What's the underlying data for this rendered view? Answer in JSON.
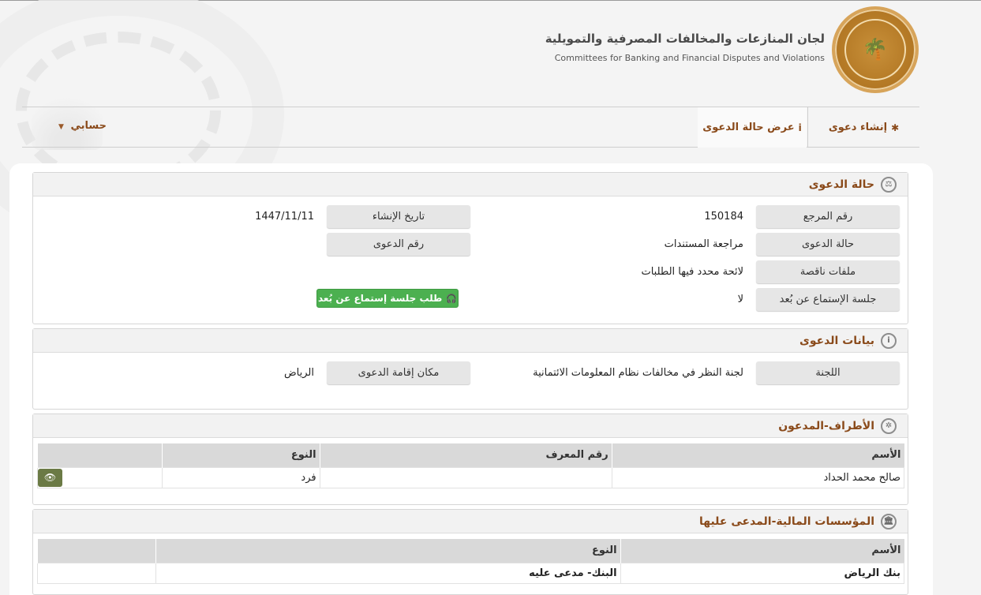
{
  "header": {
    "org_name_ar": "لجان المنازعات والمخالفات المصرفية والتمويلية",
    "org_name_en": "Committees for Banking and Financial Disputes and Violations",
    "logo_icon": "palm-swords-emblem"
  },
  "nav": {
    "create_case": "إنشاء دعوى",
    "create_case_icon": "✱",
    "view_case": "عرض حالة الدعوى",
    "view_case_icon": "i",
    "account": "حسابي",
    "account_caret": "▼"
  },
  "case_status": {
    "title": "حالة الدعوى",
    "ref_label": "رقم المرجع",
    "ref_value": "150184",
    "created_label": "تاريخ الإنشاء",
    "created_value": "1447/11/11",
    "status_label": "حالة الدعوى",
    "status_value": "مراجعة المستندات",
    "case_no_label": "رقم الدعوى",
    "missing_label": "ملفات ناقصة",
    "missing_value": "لائحة محدد فيها الطلبات",
    "remote_label": "جلسة الإستماع عن بُعد",
    "remote_value": "لا",
    "remote_button": "طلب جلسة إستماع عن بُعد",
    "remote_button_icon": "headphones-icon"
  },
  "case_data": {
    "title": "بيانات الدعوى",
    "committee_label": "اللجنة",
    "committee_value": "لجنة النظر في مخالفات نظام المعلومات الائتمانية",
    "location_label": "مكان إقامة الدعوى",
    "location_value": "الرياض"
  },
  "plaintiffs": {
    "title": "الأطراف-المدعون",
    "columns": [
      "الأسم",
      "رقم المعرف",
      "النوع"
    ],
    "rows": [
      {
        "name": "صالح محمد الحداد",
        "id": "",
        "type": "فرد"
      }
    ]
  },
  "defendants": {
    "title": "المؤسسات المالية-المدعى عليها",
    "columns": [
      "الأسم",
      "النوع"
    ],
    "rows": [
      {
        "name": "بنك الرياض",
        "type": "البنك- مدعى عليه"
      }
    ]
  }
}
